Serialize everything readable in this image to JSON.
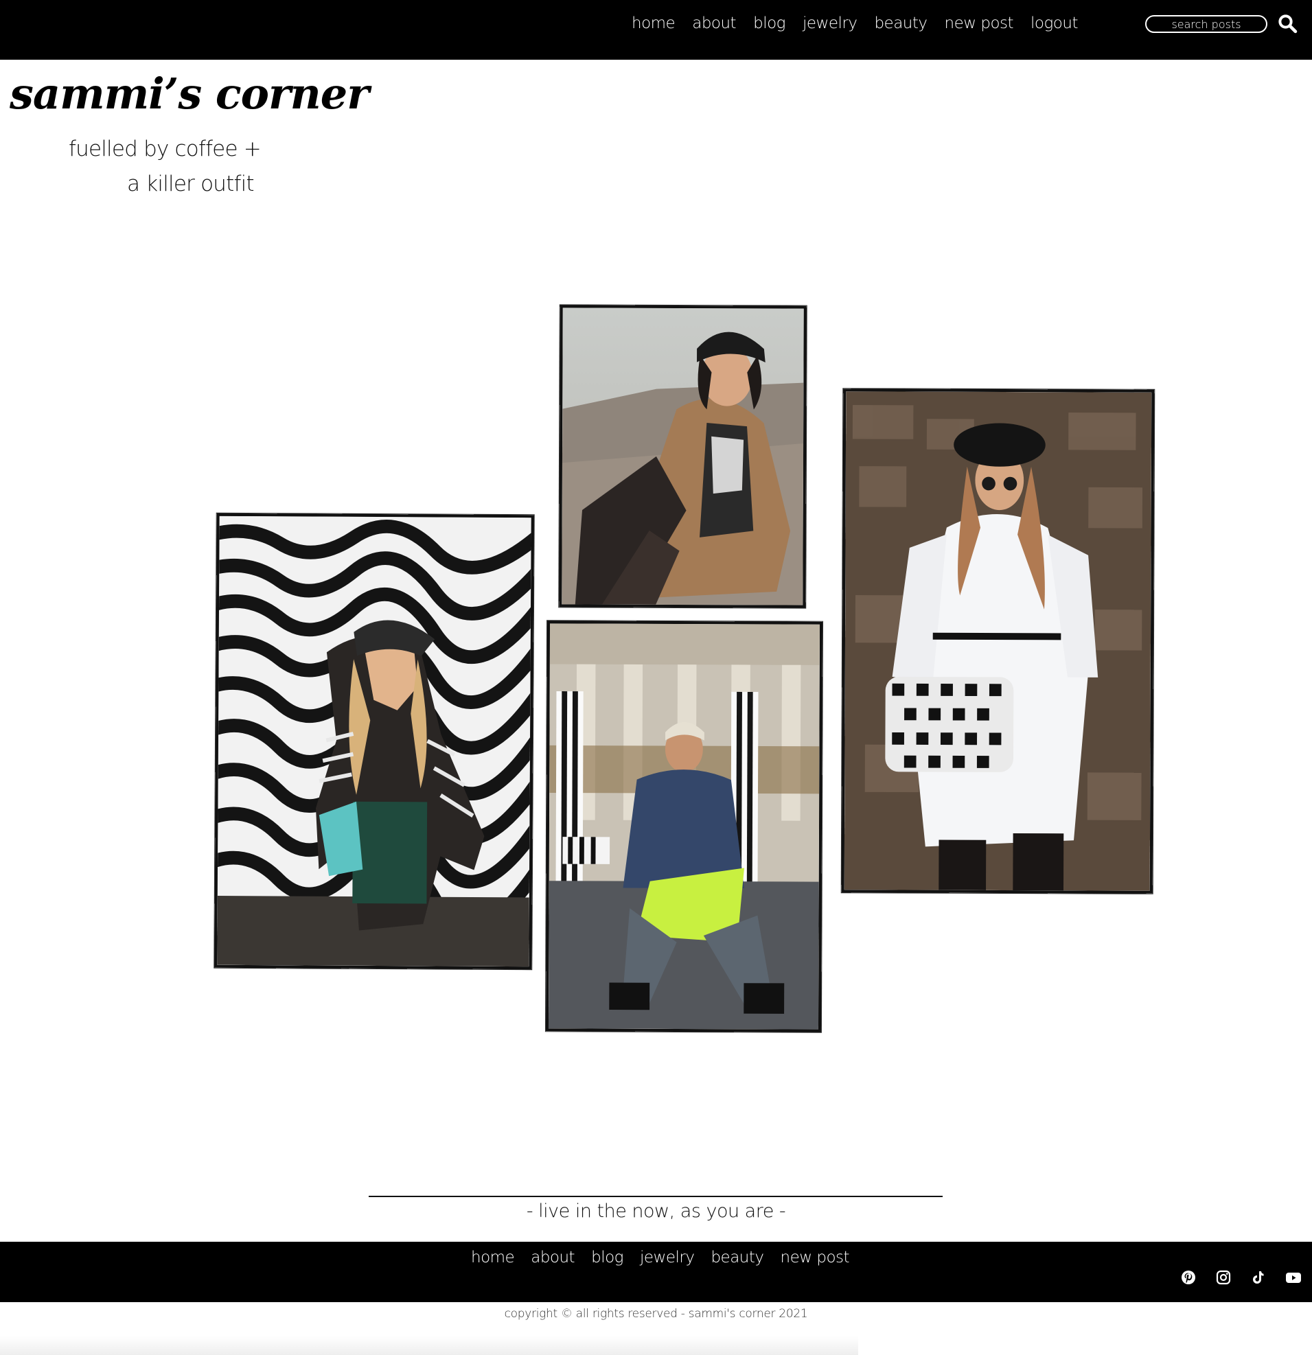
{
  "nav": {
    "items": [
      {
        "label": "home"
      },
      {
        "label": "about"
      },
      {
        "label": "blog"
      },
      {
        "label": "jewelry"
      },
      {
        "label": "beauty"
      },
      {
        "label": "new post"
      },
      {
        "label": "logout"
      }
    ],
    "search": {
      "placeholder": "search posts",
      "icon": "search-icon"
    }
  },
  "header": {
    "title": "sammi’s corner",
    "tagline_line1": "fuelled by coffee +",
    "tagline_line2": "a killer outfit"
  },
  "gallery": {
    "photos": [
      {
        "alt": "woman in striped cardigan and cap with teal bag in front of wavy black and white mural"
      },
      {
        "alt": "smiling woman in beret and teddy coat sitting on pebble beach"
      },
      {
        "alt": "woman in denim jacket and neon skirt sitting on striped columns"
      },
      {
        "alt": "woman in white shirt dress and beret holding houndstooth bag"
      }
    ]
  },
  "quote": "- live in the now, as you are -",
  "footer": {
    "nav": [
      {
        "label": "home"
      },
      {
        "label": "about"
      },
      {
        "label": "blog"
      },
      {
        "label": "jewelry"
      },
      {
        "label": "beauty"
      },
      {
        "label": "new post"
      }
    ],
    "social": [
      "pinterest-icon",
      "instagram-icon",
      "tiktok-icon",
      "youtube-icon"
    ],
    "copyright": "copyright © all rights reserved - sammi's corner 2021"
  },
  "colors": {
    "bar": "#000000",
    "background": "#ffffff",
    "text": "#111111"
  }
}
